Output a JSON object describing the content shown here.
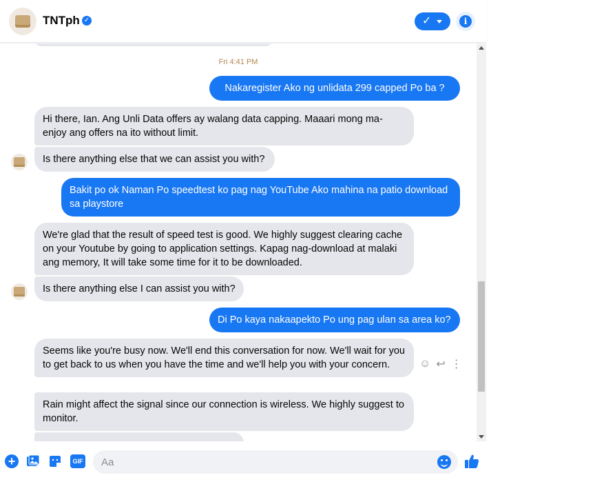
{
  "header": {
    "title": "TNTph",
    "verified_icon": "verified-check-icon",
    "done_icon": "check-icon",
    "info_icon": "info-icon"
  },
  "conversation": {
    "timestamp": "Fri 4:41 PM",
    "messages": [
      {
        "from": "user",
        "text": "Nakaregister Ako ng unlidata 299 capped Po ba ?"
      },
      {
        "from": "page",
        "text": "Hi there, Ian. Ang Unli Data offers ay walang data capping. Maaari mong ma-enjoy ang offers na ito without limit."
      },
      {
        "from": "page",
        "text": "Is there anything else that we can assist you with?"
      },
      {
        "from": "user",
        "text": "Bakit po ok Naman Po speedtest ko pag nag YouTube Ako mahina na patio download sa playstore"
      },
      {
        "from": "page",
        "text": "We're glad that the result of speed test is good. We highly suggest clearing cache on your Youtube by going to application settings. Kapag nag-download at malaki ang memory, It will take some time for it to be downloaded."
      },
      {
        "from": "page",
        "text": "Is there anything else I can assist you with?"
      },
      {
        "from": "user",
        "text": "Di Po kaya nakaapekto Po ung pag ulan sa area ko?"
      },
      {
        "from": "page",
        "text": "Seems like you're busy now. We'll end this conversation for now. We'll wait for you to get back to us when you have the time and we'll help you with your concern."
      },
      {
        "from": "page",
        "text": "Rain might affect the signal since our connection is wireless. We highly suggest to monitor."
      }
    ]
  },
  "composer": {
    "placeholder": "Aa",
    "icons": [
      "plus-icon",
      "photo-icon",
      "sticker-icon",
      "gif-icon",
      "emoji-icon",
      "thumbs-up-icon"
    ],
    "gif_label": "GIF"
  },
  "colors": {
    "accent": "#1877f2",
    "incoming_bubble": "#e4e6eb",
    "timestamp": "#b0874f"
  }
}
